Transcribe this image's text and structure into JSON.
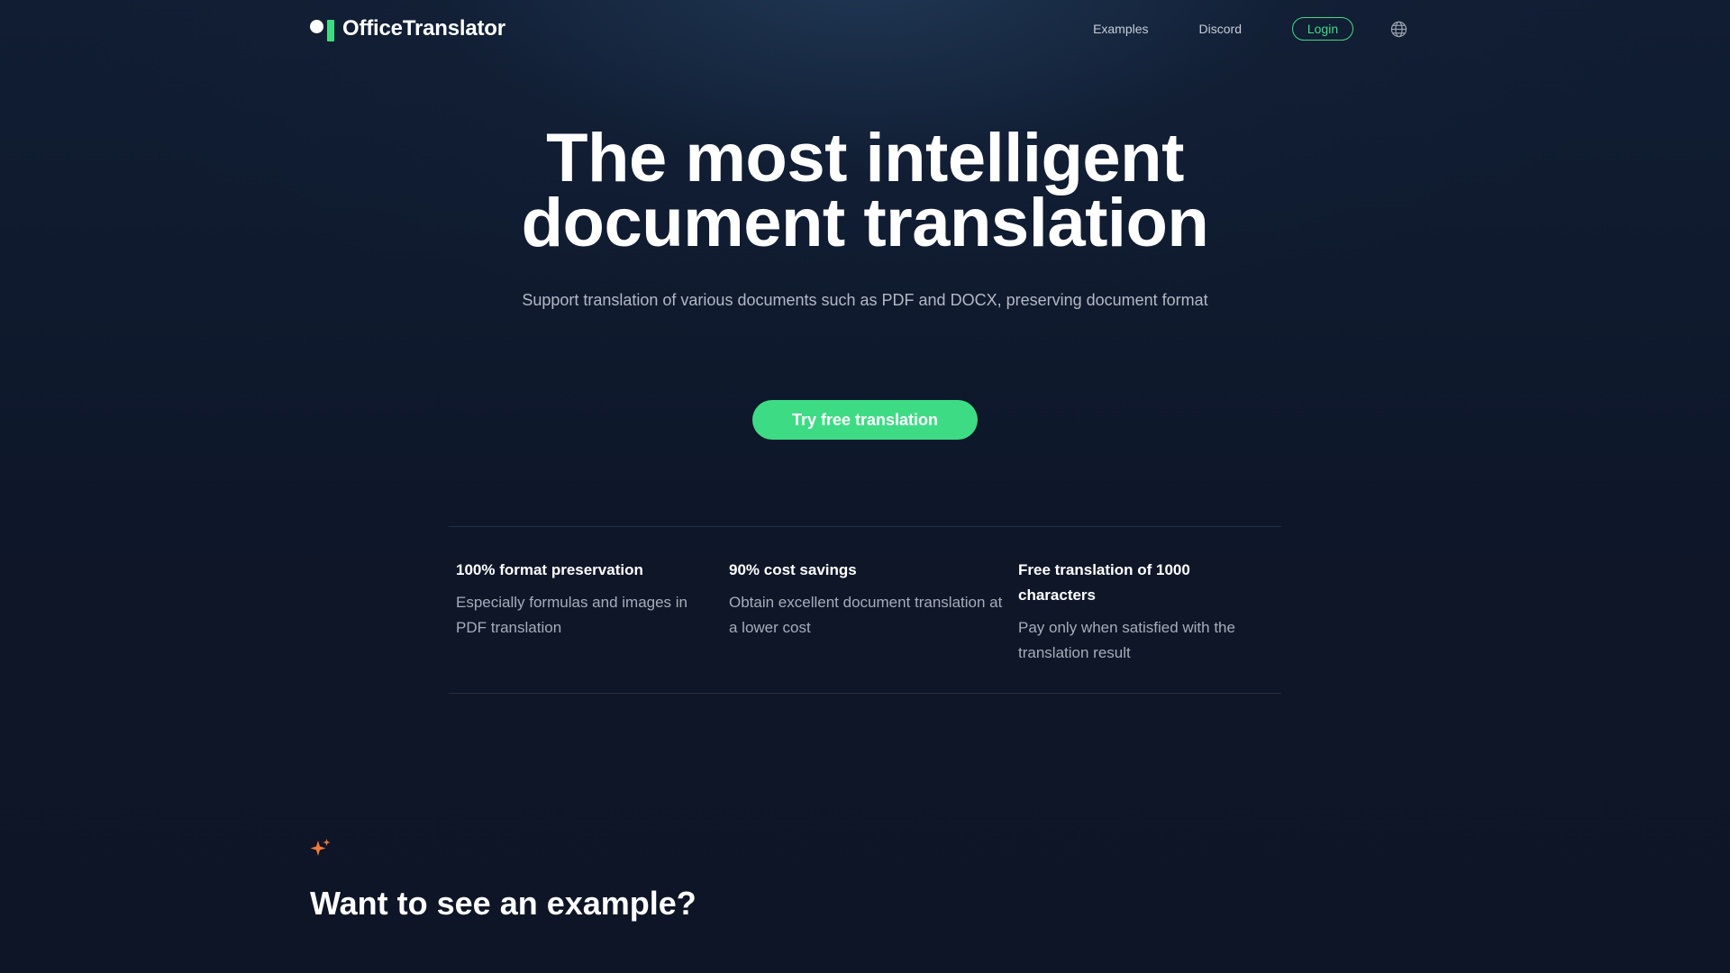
{
  "header": {
    "brand": "OfficeTranslator",
    "nav": {
      "examples": "Examples",
      "discord": "Discord",
      "login": "Login"
    },
    "language_icon": "globe-icon"
  },
  "hero": {
    "title_line1": "The most intelligent",
    "title_line2": "document translation",
    "subtitle": "Support translation of various documents such as PDF and DOCX, preserving document format",
    "cta_label": "Try free translation"
  },
  "features": [
    {
      "title": "100% format preservation",
      "description": "Especially formulas and images in PDF translation"
    },
    {
      "title": "90% cost savings",
      "description": "Obtain excellent document translation at a lower cost"
    },
    {
      "title": "Free translation of 1000 characters",
      "description": "Pay only when satisfied with the translation result"
    }
  ],
  "example_section": {
    "icon": "sparkle-icon",
    "title": "Want to see an example?"
  },
  "colors": {
    "accent": "#3ddc84",
    "background": "#0e1628",
    "sparkle": "#f07a3a"
  }
}
